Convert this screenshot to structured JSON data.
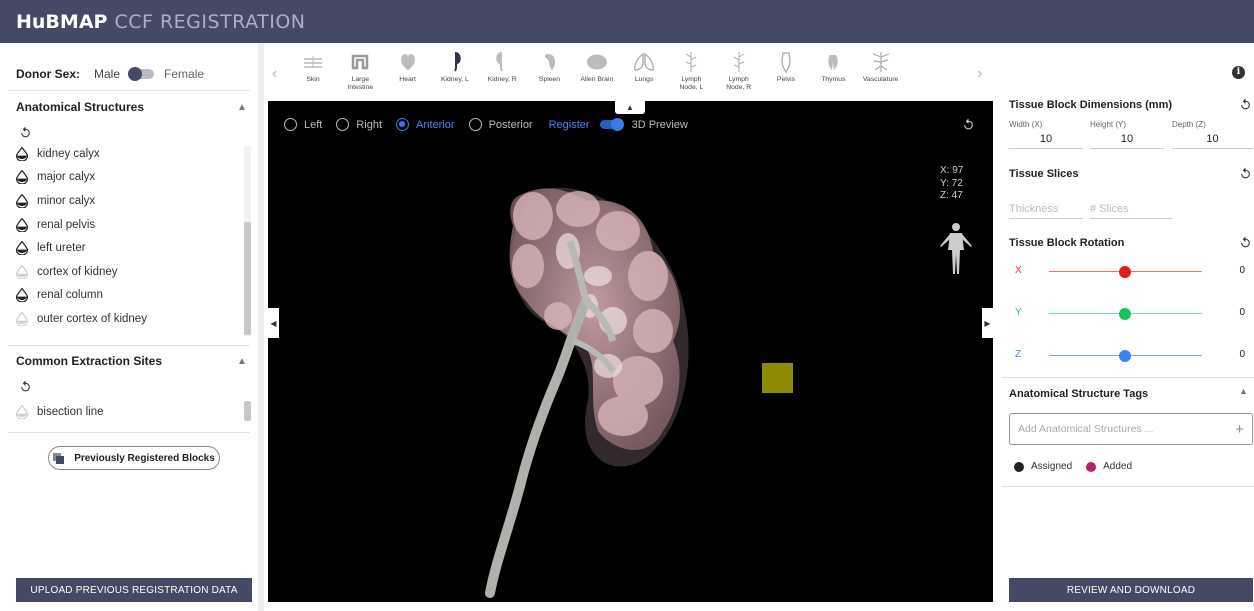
{
  "app": {
    "logo": "HuBMAP",
    "title": "CCF REGISTRATION"
  },
  "donor": {
    "label": "Donor Sex:",
    "male": "Male",
    "female": "Female"
  },
  "anatomical": {
    "title": "Anatomical Structures",
    "items": [
      {
        "label": "kidney calyx",
        "filled": true
      },
      {
        "label": "major calyx",
        "filled": true
      },
      {
        "label": "minor calyx",
        "filled": true
      },
      {
        "label": "renal pelvis",
        "filled": true
      },
      {
        "label": "left ureter",
        "filled": true
      },
      {
        "label": "cortex of kidney",
        "filled": false
      },
      {
        "label": "renal column",
        "filled": true
      },
      {
        "label": "outer cortex of kidney",
        "filled": false
      }
    ]
  },
  "extraction": {
    "title": "Common Extraction Sites",
    "items": [
      {
        "label": "bisection line",
        "filled": false
      }
    ]
  },
  "buttons": {
    "previous_blocks": "Previously Registered Blocks",
    "upload": "UPLOAD PREVIOUS REGISTRATION DATA",
    "review": "REVIEW AND DOWNLOAD"
  },
  "organs": [
    "Skin",
    "Large\nIntestine",
    "Heart",
    "Kidney, L",
    "Kidney, R",
    "Spleen",
    "Allen Brain",
    "Lungs",
    "Lymph\nNode, L",
    "Lymph\nNode, R",
    "Pelvis",
    "Thymus",
    "Vasculature"
  ],
  "view": {
    "left": "Left",
    "right": "Right",
    "anterior": "Anterior",
    "posterior": "Posterior",
    "register": "Register",
    "preview": "3D Preview",
    "coords": {
      "x": "X: 97",
      "y": "Y: 72",
      "z": "Z: 47"
    }
  },
  "dimensions": {
    "title": "Tissue Block Dimensions (mm)",
    "width_label": "Width (X)",
    "width": "10",
    "height_label": "Height (Y)",
    "height": "10",
    "depth_label": "Depth (Z)",
    "depth": "10"
  },
  "slices": {
    "title": "Tissue Slices",
    "thickness": "Thickness",
    "count": "# Slices"
  },
  "rotation": {
    "title": "Tissue Block Rotation",
    "x_label": "X",
    "x": "0",
    "x_color": "#e53935",
    "y_label": "Y",
    "y": "0",
    "y_color": "#22c55e",
    "z_label": "Z",
    "z": "0",
    "z_color": "#3b82f6"
  },
  "tags": {
    "title": "Anatomical Structure Tags",
    "placeholder": "Add Anatomical Structures ...",
    "assigned": "Assigned",
    "assigned_color": "#222222",
    "added": "Added",
    "added_color": "#b0226b"
  }
}
